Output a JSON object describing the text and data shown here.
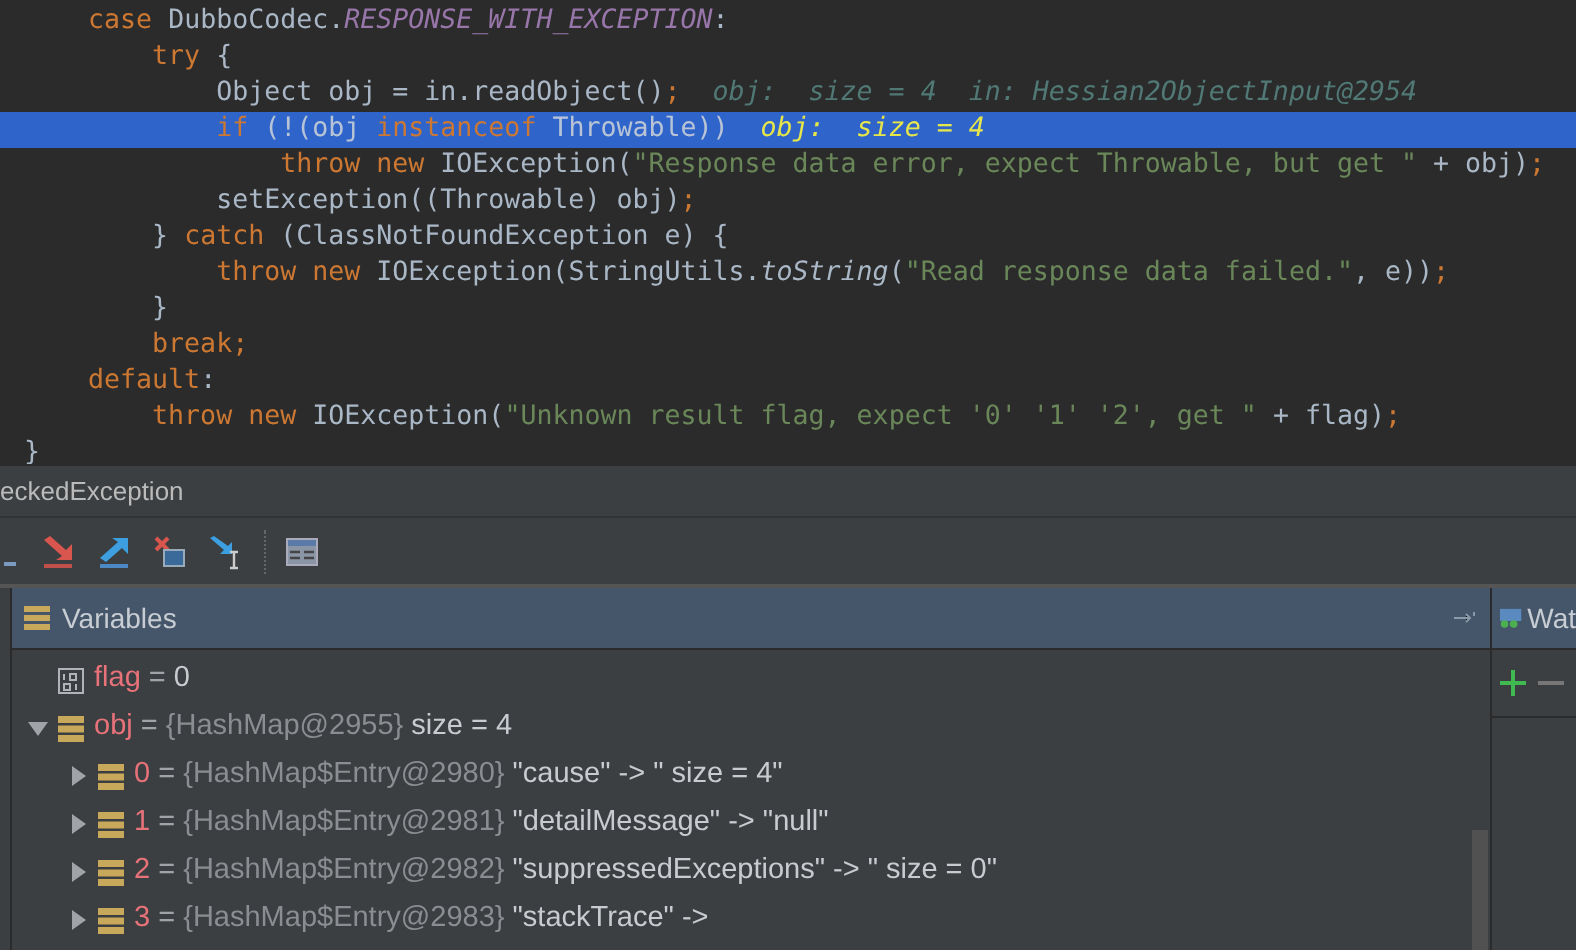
{
  "code_lines": [
    {
      "selected": false,
      "segments": [
        {
          "text": "    case ",
          "kind": "keyword"
        },
        {
          "text": "DubboCodec.",
          "kind": "plain"
        },
        {
          "text": "RESPONSE_WITH_EXCEPTION",
          "kind": "constant"
        },
        {
          "text": ":",
          "kind": "plain"
        }
      ]
    },
    {
      "selected": false,
      "segments": [
        {
          "text": "        try ",
          "kind": "keyword"
        },
        {
          "text": "{",
          "kind": "plain"
        }
      ]
    },
    {
      "selected": false,
      "segments": [
        {
          "text": "            Object obj = in.readObject()",
          "kind": "plain"
        },
        {
          "text": ";",
          "kind": "keyword"
        },
        {
          "text": "  obj:  size = 4  in: Hessian2ObjectInput@2954",
          "kind": "hint"
        }
      ]
    },
    {
      "selected": true,
      "segments": [
        {
          "text": "            if ",
          "kind": "keyword"
        },
        {
          "text": "(!(obj ",
          "kind": "plain"
        },
        {
          "text": "instanceof ",
          "kind": "keyword"
        },
        {
          "text": "Throwable))",
          "kind": "plain"
        },
        {
          "text": "  obj:  size = 4",
          "kind": "hint"
        }
      ]
    },
    {
      "selected": false,
      "segments": [
        {
          "text": "                throw new ",
          "kind": "keyword"
        },
        {
          "text": "IOException(",
          "kind": "plain"
        },
        {
          "text": "\"Response data error, expect Throwable, but get \"",
          "kind": "string"
        },
        {
          "text": " + obj)",
          "kind": "plain"
        },
        {
          "text": ";",
          "kind": "keyword"
        }
      ]
    },
    {
      "selected": false,
      "segments": [
        {
          "text": "            setException((Throwable) obj)",
          "kind": "plain"
        },
        {
          "text": ";",
          "kind": "keyword"
        }
      ]
    },
    {
      "selected": false,
      "segments": [
        {
          "text": "        } ",
          "kind": "plain"
        },
        {
          "text": "catch ",
          "kind": "keyword"
        },
        {
          "text": "(ClassNotFoundException e) {",
          "kind": "plain"
        }
      ]
    },
    {
      "selected": false,
      "segments": [
        {
          "text": "            throw new ",
          "kind": "keyword"
        },
        {
          "text": "IOException(StringUtils.",
          "kind": "plain"
        },
        {
          "text": "toString",
          "kind": "method"
        },
        {
          "text": "(",
          "kind": "plain"
        },
        {
          "text": "\"Read response data failed.\"",
          "kind": "string"
        },
        {
          "text": ", e))",
          "kind": "plain"
        },
        {
          "text": ";",
          "kind": "keyword"
        }
      ]
    },
    {
      "selected": false,
      "segments": [
        {
          "text": "        }",
          "kind": "plain"
        }
      ]
    },
    {
      "selected": false,
      "segments": [
        {
          "text": "        break;",
          "kind": "keyword"
        }
      ]
    },
    {
      "selected": false,
      "segments": [
        {
          "text": "    default",
          "kind": "keyword"
        },
        {
          "text": ":",
          "kind": "plain"
        }
      ]
    },
    {
      "selected": false,
      "segments": [
        {
          "text": "        throw new ",
          "kind": "keyword"
        },
        {
          "text": "IOException(",
          "kind": "plain"
        },
        {
          "text": "\"Unknown result flag, expect '0' '1' '2', get \"",
          "kind": "string"
        },
        {
          "text": " + flag)",
          "kind": "plain"
        },
        {
          "text": ";",
          "kind": "keyword"
        }
      ]
    },
    {
      "selected": false,
      "segments": [
        {
          "text": "}",
          "kind": "plain"
        }
      ]
    }
  ],
  "frame_title": "eckedException",
  "variables_panel": {
    "title": "Variables",
    "items": [
      {
        "kind": "primitive",
        "name": "flag",
        "operator": "=",
        "value": "0"
      },
      {
        "kind": "object",
        "name": "obj",
        "operator": "=",
        "type": "{HashMap@2955}",
        "value": "size = 4",
        "expanded": true,
        "children": [
          {
            "kind": "object",
            "name": "0",
            "operator": "=",
            "type": "{HashMap$Entry@2980}",
            "value": "\"cause\" -> \" size = 4\"",
            "expanded": false
          },
          {
            "kind": "object",
            "name": "1",
            "operator": "=",
            "type": "{HashMap$Entry@2981}",
            "value": "\"detailMessage\" -> \"null\"",
            "expanded": false
          },
          {
            "kind": "object",
            "name": "2",
            "operator": "=",
            "type": "{HashMap$Entry@2982}",
            "value": "\"suppressedExceptions\" -> \" size = 0\"",
            "expanded": false
          },
          {
            "kind": "object",
            "name": "3",
            "operator": "=",
            "type": "{HashMap$Entry@2983}",
            "value": "\"stackTrace\" ->",
            "expanded": false
          }
        ]
      }
    ]
  },
  "watches_panel": {
    "title": "Wat"
  }
}
